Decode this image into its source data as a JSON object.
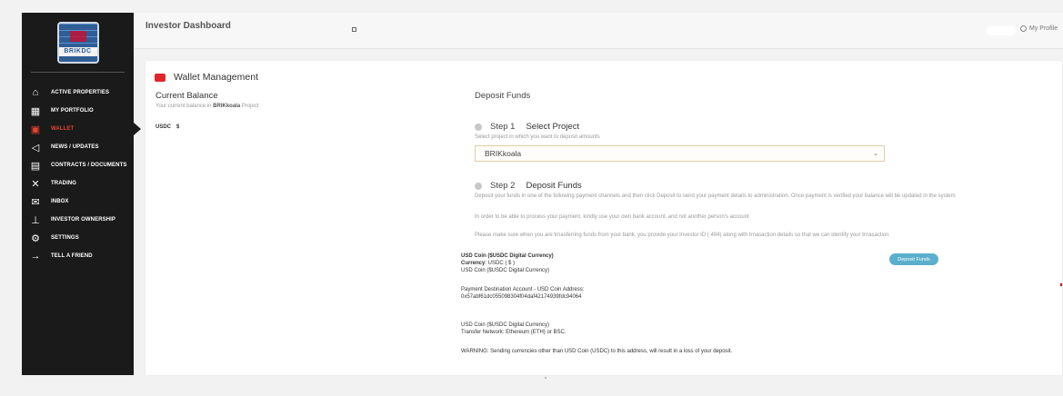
{
  "sidebar": {
    "logo_text": "BRIKDC",
    "items": [
      {
        "icon": "home-icon",
        "glyph": "⌂",
        "label": "ACTIVE PROPERTIES",
        "active": false
      },
      {
        "icon": "grid-icon",
        "glyph": "▦",
        "label": "MY PORTFOLIO",
        "active": false
      },
      {
        "icon": "wallet-icon",
        "glyph": "▣",
        "label": "WALLET",
        "active": true
      },
      {
        "icon": "megaphone-icon",
        "glyph": "◁",
        "label": "NEWS / UPDATES",
        "active": false
      },
      {
        "icon": "document-icon",
        "glyph": "▤",
        "label": "CONTRACTS / DOCUMENTS",
        "active": false
      },
      {
        "icon": "trading-icon",
        "glyph": "✕",
        "label": "TRADING",
        "active": false
      },
      {
        "icon": "inbox-icon",
        "glyph": "✉",
        "label": "INBOX",
        "active": false
      },
      {
        "icon": "ownership-icon",
        "glyph": "⊥",
        "label": "INVESTOR OWNERSHIP",
        "active": false
      },
      {
        "icon": "gear-icon",
        "glyph": "⚙",
        "label": "SETTINGS",
        "active": false
      },
      {
        "icon": "arrow-right-icon",
        "glyph": "→",
        "label": "TELL A FRIEND",
        "active": false
      }
    ]
  },
  "header": {
    "title": "Investor Dashboard",
    "profile_label": "My Profile"
  },
  "wallet": {
    "title": "Wallet Management",
    "current_balance": "Current Balance",
    "balance_sub_prefix": "Your current balance in ",
    "balance_sub_project": "BRIKkoala",
    "balance_sub_suffix": " Project",
    "currency": "USDC",
    "currency_symbol": "$"
  },
  "deposit": {
    "title": "Deposit Funds",
    "step1_label": "Step 1",
    "step1_name": "Select Project",
    "step1_hint": "Select project in which you want to deposit amounts",
    "project_selected": "BRIKkoala",
    "step2_label": "Step 2",
    "step2_name": "Deposit Funds",
    "step2_hint": "Deposit your funds in one of the following payment channels and then click Deposit to send your payment details to administration. Once payment is verified your balance will be updated in the system",
    "note_own_account": "In order to be able to process your payment, kindly use your own bank account, and not another person's account",
    "note_investor_id": "Please make sure when you are trnasferring funds from your bank, you provide your Investor ID ( 494) along with trnasaction details so that we can identify your trnasaction",
    "coin_title": "USD Coin ($USDC Digital Currency)",
    "currency_label": "Currency",
    "currency_value": ": USDC ( $ )",
    "coin_line": "USD Coin ($USDC Digital Currency)",
    "dest_label": "Payment Destination Account - USD Coin Address:",
    "dest_address": "0x57abf61dc055098304f04daf42174939fdc94064",
    "coin_line2": "USD Coin ($USDC Digital Currency)",
    "network": "Transfer Network: Ethereum (ETH) or BSC.",
    "warning": "WARNING: Sending currencies other than USD Coin (USDC) to this address, will result in a loss of your deposit.",
    "button_label": "Deposit Funds"
  }
}
